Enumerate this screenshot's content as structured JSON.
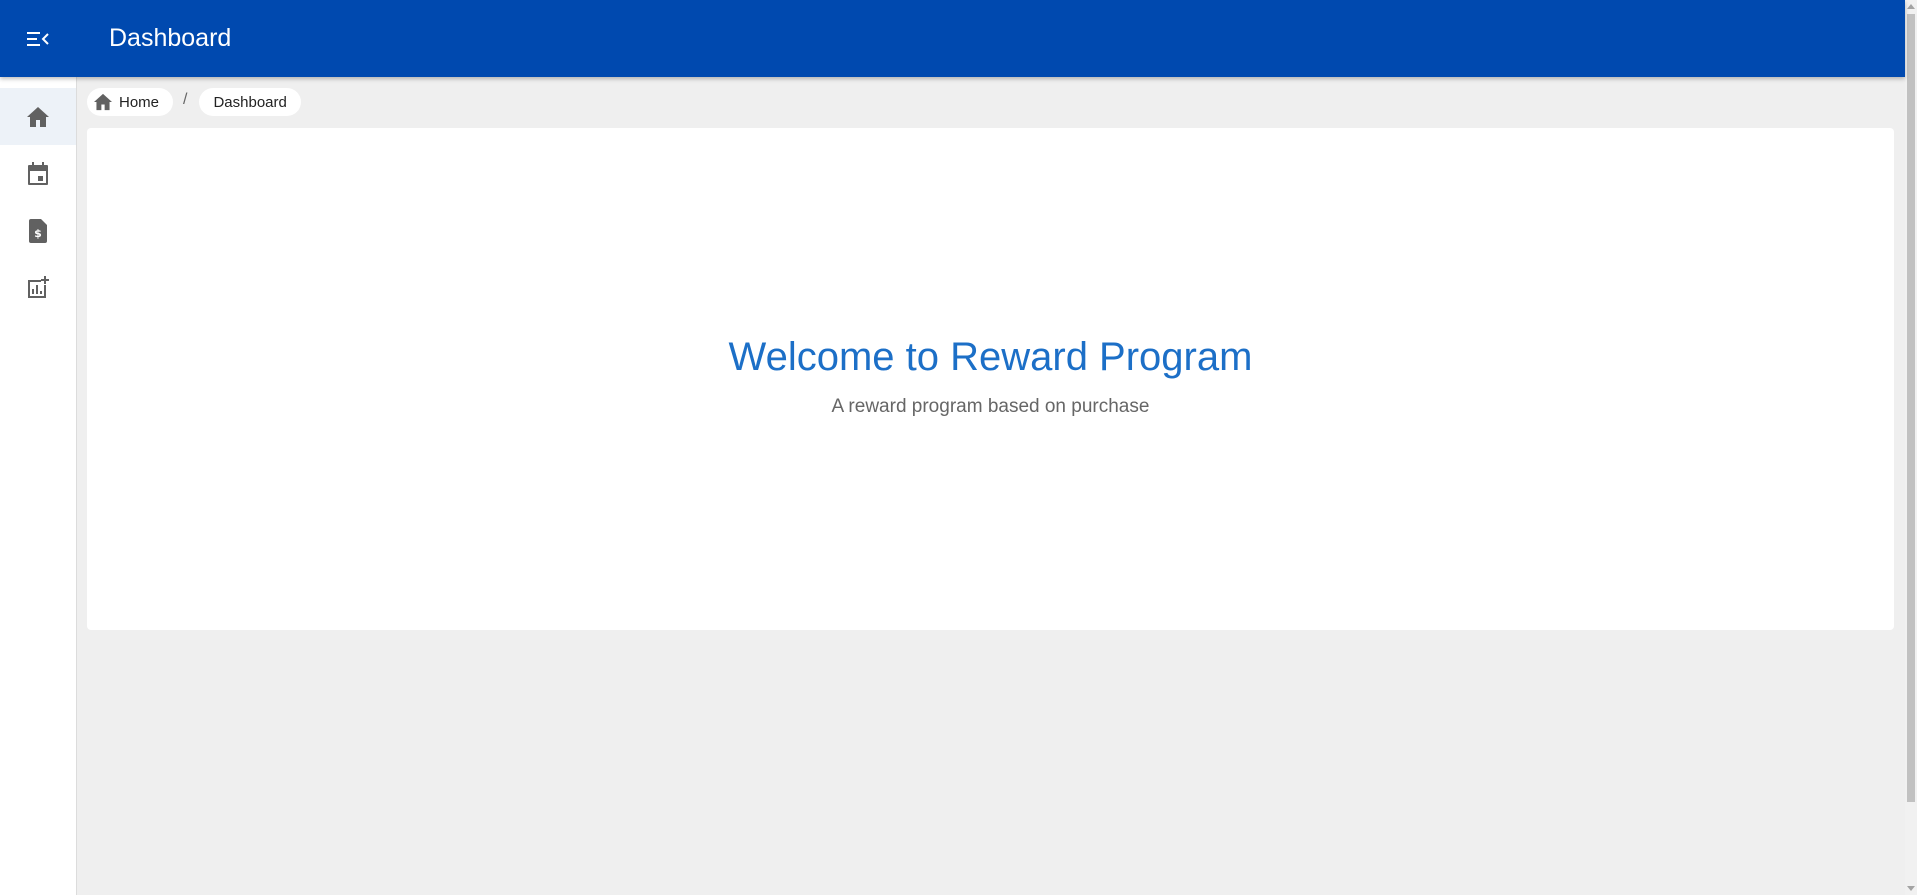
{
  "appbar": {
    "title": "Dashboard",
    "menu_icon": "menu-open-icon",
    "color": "#0049af"
  },
  "sidebar": {
    "items": [
      {
        "icon": "home-icon",
        "active": true
      },
      {
        "icon": "calendar-icon",
        "active": false
      },
      {
        "icon": "invoice-dollar-icon",
        "active": false
      },
      {
        "icon": "add-chart-icon",
        "active": false
      }
    ]
  },
  "breadcrumb": {
    "items": [
      {
        "label": "Home",
        "icon": "home-icon"
      },
      {
        "label": "Dashboard"
      }
    ],
    "separator": "/"
  },
  "main": {
    "heading": "Welcome to Reward Program",
    "subheading": "A reward program based on purchase",
    "heading_color": "#1c6fc7"
  }
}
